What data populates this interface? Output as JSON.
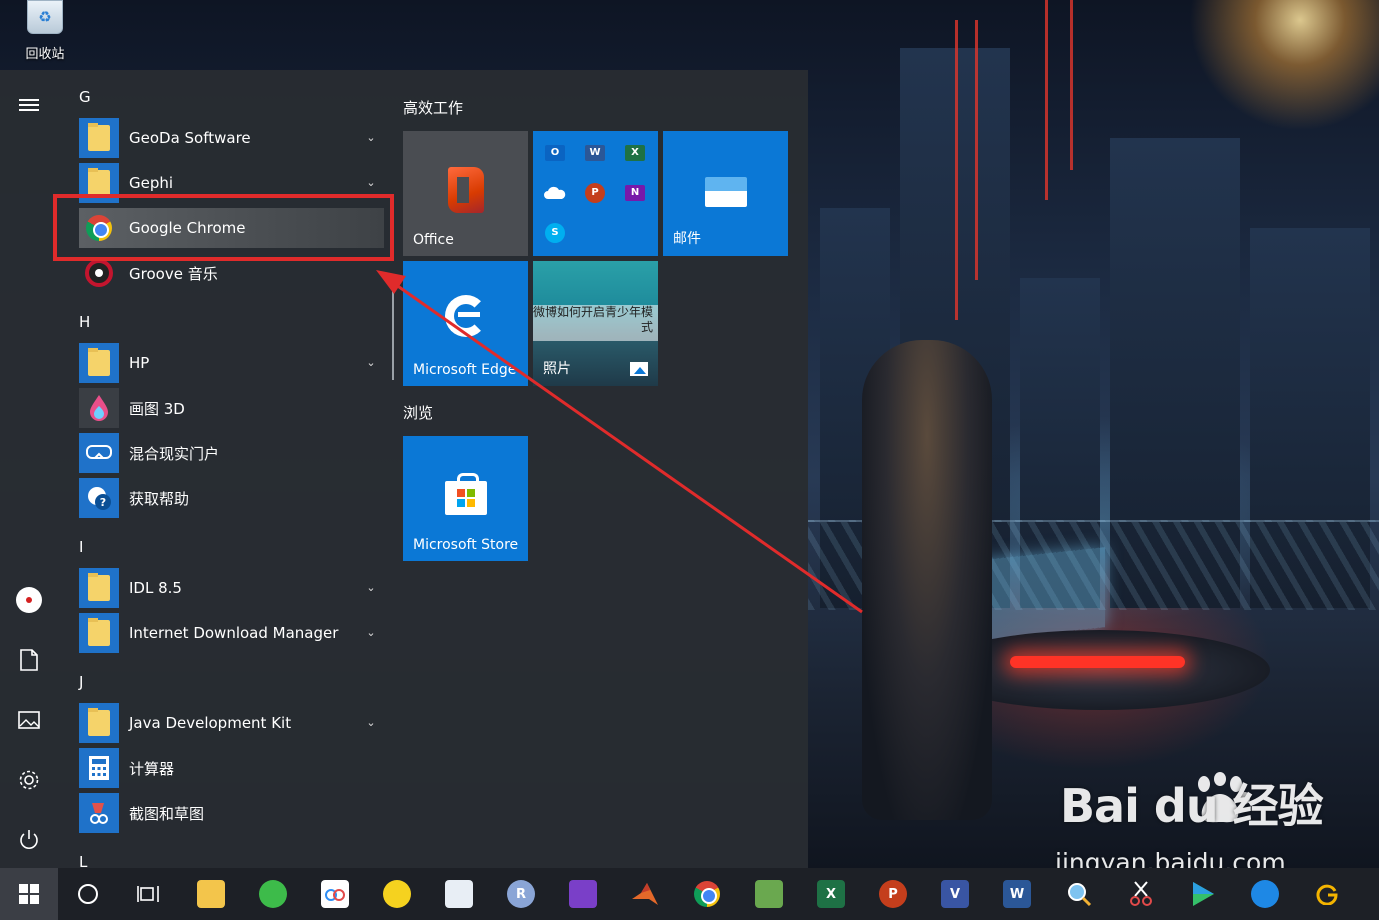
{
  "desktop": {
    "recycle_bin_label": "回收站"
  },
  "start_menu": {
    "left_rail": {
      "items": [
        "menu-icon",
        "user-avatar",
        "documents-icon",
        "pictures-icon",
        "settings-icon",
        "power-icon"
      ]
    },
    "app_list": {
      "letters": {
        "g": "G",
        "h": "H",
        "i": "I",
        "j": "J",
        "l": "L"
      },
      "apps": {
        "geoda": "GeoDa Software",
        "gephi": "Gephi",
        "chrome": "Google Chrome",
        "groove": "Groove 音乐",
        "hp": "HP",
        "paint3d": "画图 3D",
        "mixed_reality": "混合现实门户",
        "get_help": "获取帮助",
        "idl": "IDL 8.5",
        "idm": "Internet Download Manager",
        "jdk": "Java Development Kit",
        "calculator": "计算器",
        "snip_sketch": "截图和草图"
      },
      "chevron_glyph": "⌄"
    },
    "tiles": {
      "group1_title": "高效工作",
      "group2_title": "浏览",
      "office": "Office",
      "mail": "邮件",
      "edge": "Microsoft Edge",
      "photos": "照片",
      "photos_caption": "微博如何开启青少年模式",
      "store": "Microsoft Store",
      "mini_apps": {
        "outlook": "O",
        "word": "W",
        "excel": "X",
        "powerpoint": "P",
        "onenote": "N",
        "skype": "S"
      }
    }
  },
  "annotation": {
    "highlight_color": "#e02b2b"
  },
  "watermark": {
    "logo_text": "Bai du 经验",
    "url": "jingyan.baidu.com"
  },
  "taskbar": {
    "icons": [
      "start",
      "search",
      "task-view",
      "file-explorer",
      "browser-360",
      "baidu-netdisk",
      "qq-music",
      "notepad-editor",
      "r-lang",
      "visual-studio",
      "matlab",
      "chrome",
      "photo-viewer",
      "excel",
      "powerpoint",
      "visio",
      "word",
      "search-tool",
      "snipping",
      "media-player",
      "teamviewer",
      "google-g"
    ],
    "labels": {
      "r": "R",
      "excel": "X",
      "powerpoint": "P",
      "visio": "V",
      "word": "W"
    }
  },
  "colors": {
    "tile_blue": "#0b78d6",
    "menu_bg": "#2c3036",
    "taskbar_bg": "#1d2026",
    "annotation_red": "#e02b2b"
  }
}
